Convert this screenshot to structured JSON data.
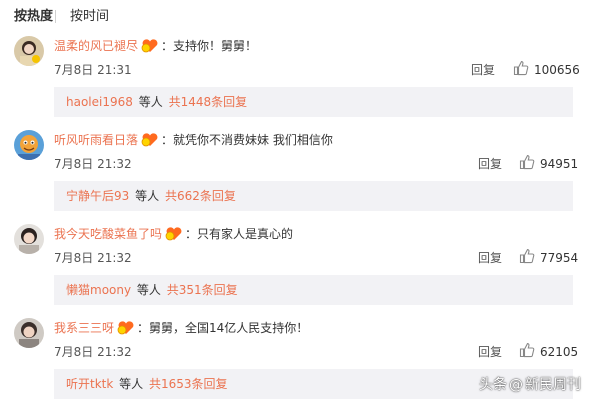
{
  "sort": {
    "hot_label": "按热度",
    "time_label": "按时间"
  },
  "comments": [
    {
      "user": "温柔的风已褪尽",
      "text": "：支持你！舅舅！",
      "date": "7月8日 21:31",
      "reply_label": "回复",
      "likes": "100656",
      "reply_user": "haolei1968",
      "reply_mid": "等人",
      "reply_count": "共1448条回复"
    },
    {
      "user": "听风听雨看日落",
      "text": "：就凭你不消费妹妹 我们相信你",
      "date": "7月8日 21:32",
      "reply_label": "回复",
      "likes": "94951",
      "reply_user": "宁静午后93",
      "reply_mid": "等人",
      "reply_count": "共662条回复"
    },
    {
      "user": "我今天吃酸菜鱼了吗",
      "text": "：只有家人是真心的",
      "date": "7月8日 21:32",
      "reply_label": "回复",
      "likes": "77954",
      "reply_user": "懒猫moony",
      "reply_mid": "等人",
      "reply_count": "共351条回复"
    },
    {
      "user": "我系三三呀",
      "text": "：舅舅，全国14亿人民支持你！",
      "date": "7月8日 21:32",
      "reply_label": "回复",
      "likes": "62105",
      "reply_user": "听开tktk",
      "reply_mid": "等人",
      "reply_count": "共1653条回复"
    }
  ],
  "watermark": {
    "prefix": "头条",
    "at": "@",
    "name": "新民周刊"
  },
  "colors": {
    "link": "#eb7350",
    "reply_bg": "#f2f2f5",
    "text": "#333333"
  }
}
